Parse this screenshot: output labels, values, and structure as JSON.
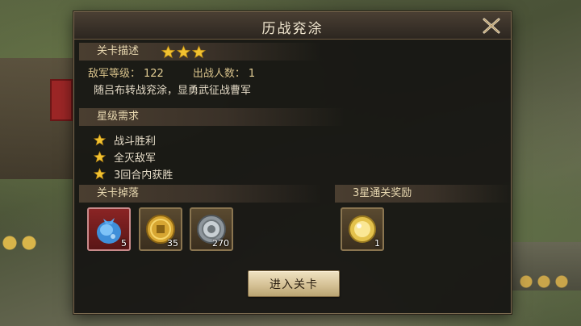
{
  "dialog": {
    "title": "历战兖涂",
    "close_icon": "close-x-icon"
  },
  "stage": {
    "header": "关卡描述",
    "stars": 3,
    "enemy_level_label": "敌军等级：",
    "enemy_level": "122",
    "troops_label": "出战人数：",
    "troops": "1",
    "description": "随吕布转战兖涂，显勇武征战曹军"
  },
  "requirements": {
    "header": "星级需求",
    "items": [
      "战斗胜利",
      "全灭敌军",
      "3回合内获胜"
    ]
  },
  "drops": {
    "header": "关卡掉落",
    "items": [
      {
        "icon": "blue-gem-pouch-icon",
        "count": "5"
      },
      {
        "icon": "gold-coin-icon",
        "count": "35"
      },
      {
        "icon": "silver-coin-icon",
        "count": "270"
      }
    ]
  },
  "reward": {
    "header": "3星通关奖励",
    "items": [
      {
        "icon": "gold-medal-icon",
        "count": "1"
      }
    ]
  },
  "enter_button": "进入关卡",
  "colors": {
    "accent_gold": "#d6c08a",
    "star": "#f2c230",
    "dialog_bg": "#161412",
    "button_bg": "#d6c296"
  }
}
